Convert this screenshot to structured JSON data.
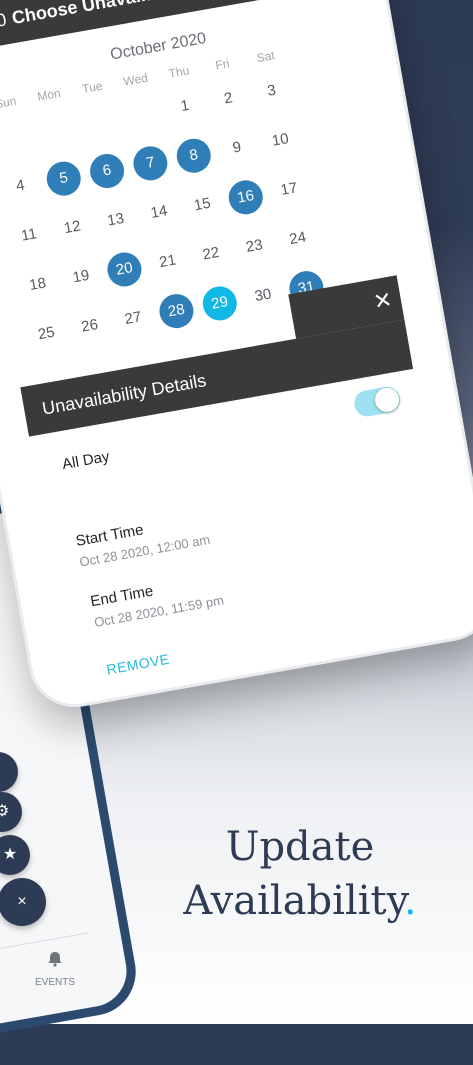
{
  "calendar": {
    "header_year": "2020",
    "header_title": "Choose Unavaila",
    "month_label": "October 2020",
    "weekdays": [
      "Sun",
      "Mon",
      "Tue",
      "Wed",
      "Thu",
      "Fri",
      "Sat"
    ],
    "weeks": [
      [
        "",
        "",
        "",
        "",
        "1",
        "2",
        "3"
      ],
      [
        "4",
        "5",
        "6",
        "7",
        "8",
        "9",
        "10"
      ],
      [
        "11",
        "12",
        "13",
        "14",
        "15",
        "16",
        "17"
      ],
      [
        "18",
        "19",
        "20",
        "21",
        "22",
        "23",
        "24"
      ],
      [
        "25",
        "26",
        "27",
        "28",
        "29",
        "30",
        "31"
      ]
    ],
    "selected_days": [
      "5",
      "6",
      "7",
      "8",
      "16",
      "20",
      "28",
      "31"
    ],
    "today_day": "29"
  },
  "details": {
    "title": "Unavailability Details",
    "close_icon": "close-icon",
    "all_day_label": "All Day",
    "all_day_on": true,
    "start_label": "Start Time",
    "start_value": "Oct 28 2020, 12:00 am",
    "end_label": "End Time",
    "end_value": "Oct 28 2020, 11:59 pm",
    "remove_label": "REMOVE"
  },
  "second_phone": {
    "fab_icons": [
      "circle-icon",
      "gear-icon",
      "star-icon",
      "close-icon"
    ],
    "fab_close_glyph": "×",
    "fab_star_glyph": "★",
    "tab_events_label": "EVENTS",
    "tab_events_icon": "bell-icon"
  },
  "headline": {
    "line1": "Update",
    "line2": "Availability",
    "dot": "."
  },
  "colors": {
    "selected": "#2f7eb7",
    "today": "#11b8e6",
    "dark_bar": "#3a3a3a",
    "brand_navy": "#2e3b55",
    "accent": "#11b8e6"
  }
}
